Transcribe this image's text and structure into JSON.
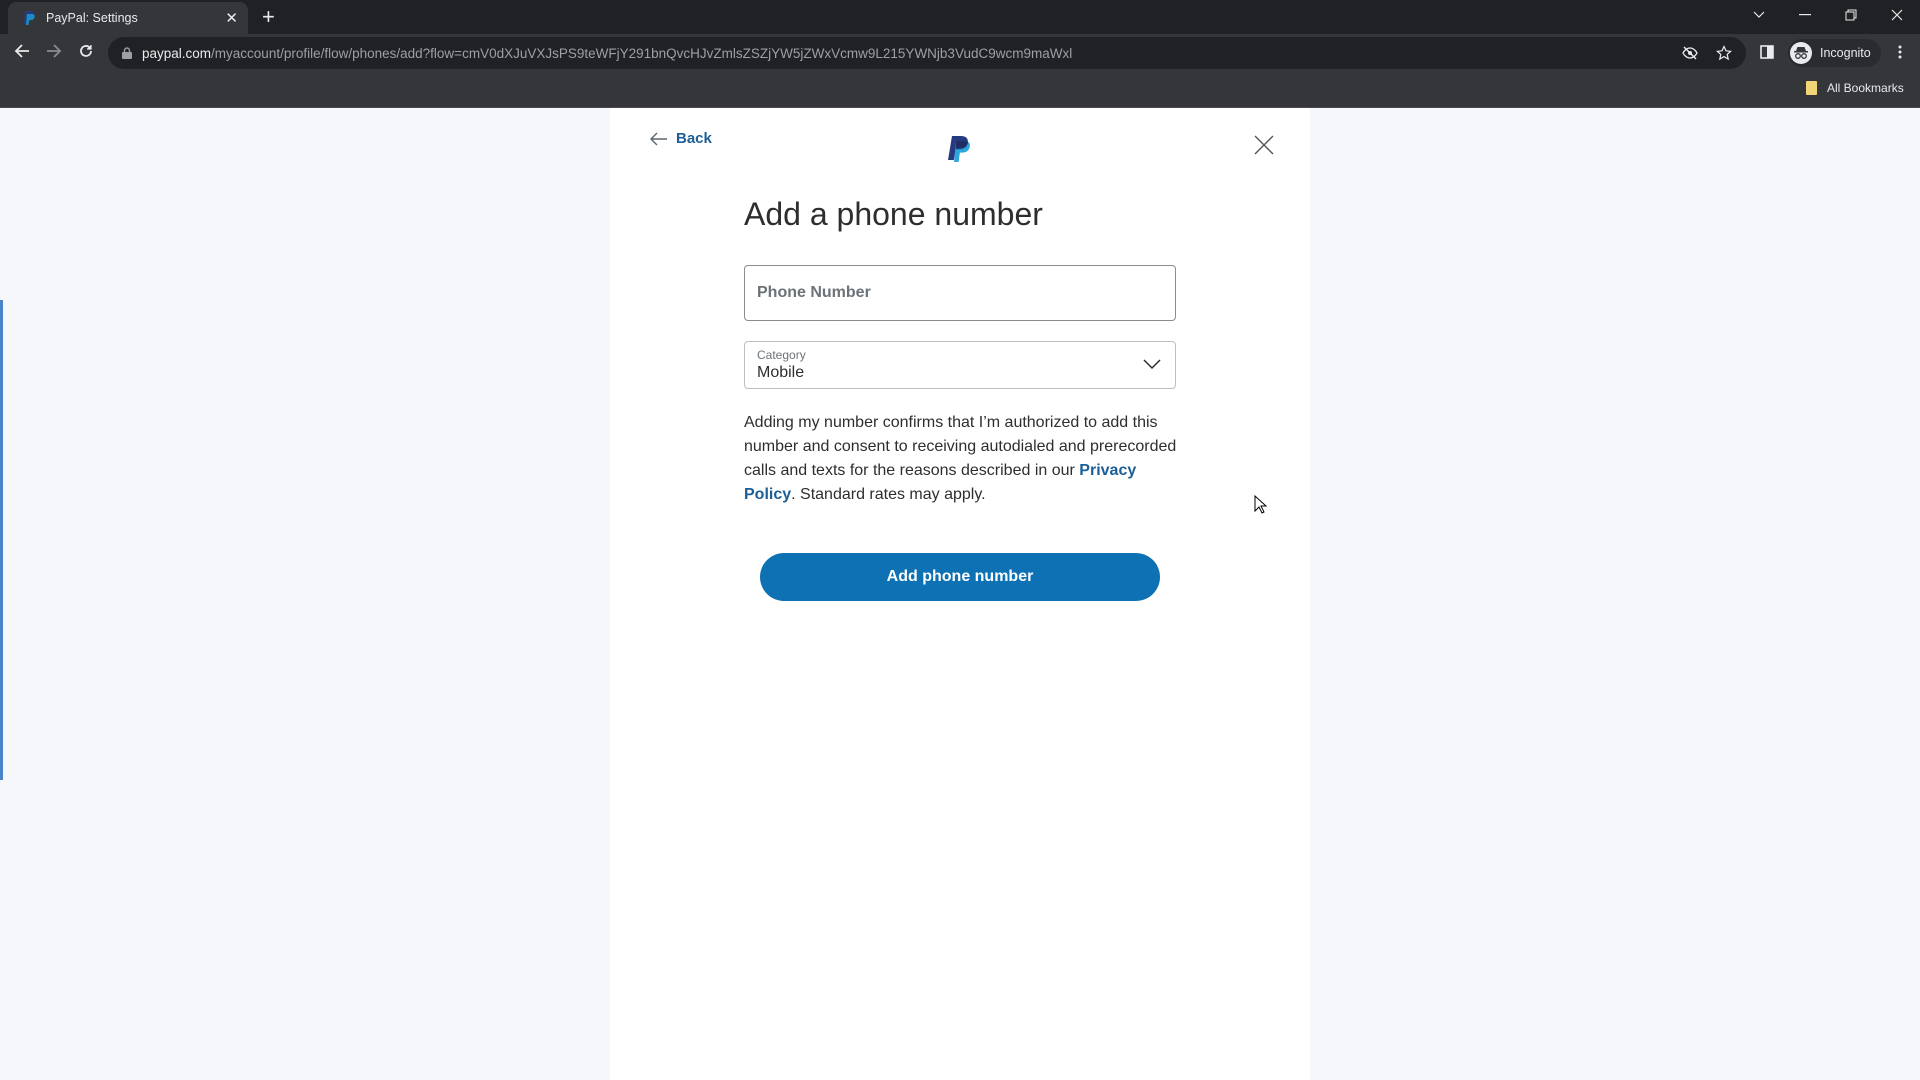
{
  "browser": {
    "tab": {
      "title": "PayPal: Settings"
    },
    "url": {
      "host": "paypal.com",
      "path": "/myaccount/profile/flow/phones/add?flow=cmV0dXJuVXJsPS9teWFjY291bnQvcHJvZmlsZSZjYW5jZWxVcmw9L215YWNjb3VudC9wcm9maWxl"
    },
    "profile_label": "Incognito",
    "bookmarks_label": "All Bookmarks"
  },
  "page": {
    "back_label": "Back",
    "heading": "Add a phone number",
    "phone_field": {
      "placeholder": "Phone Number",
      "value": ""
    },
    "category_field": {
      "label": "Category",
      "selected": "Mobile"
    },
    "consent": {
      "text_before": "Adding my number confirms that I’m authorized to add this number and consent to receiving autodialed and prerecorded calls and texts for the reasons described in our ",
      "link": "Privacy Policy",
      "text_after": ". Standard rates may apply."
    },
    "submit_label": "Add phone number"
  },
  "colors": {
    "brand_blue": "#0e71b4",
    "link_blue": "#1b5f96",
    "paypal_dark": "#253b80",
    "paypal_light": "#179bd7"
  }
}
